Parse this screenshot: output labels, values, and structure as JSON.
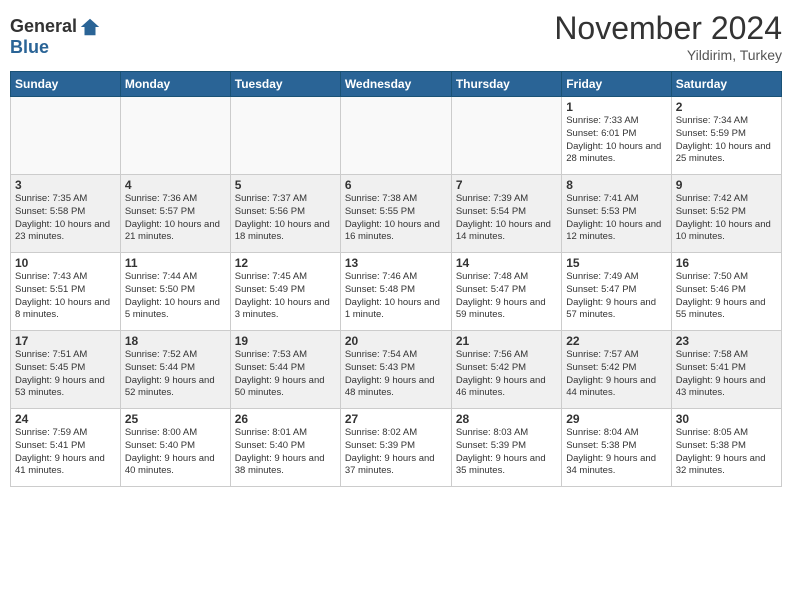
{
  "header": {
    "logo_general": "General",
    "logo_blue": "Blue",
    "month_title": "November 2024",
    "location": "Yildirim, Turkey"
  },
  "days_of_week": [
    "Sunday",
    "Monday",
    "Tuesday",
    "Wednesday",
    "Thursday",
    "Friday",
    "Saturday"
  ],
  "weeks": [
    [
      {
        "day": "",
        "empty": true
      },
      {
        "day": "",
        "empty": true
      },
      {
        "day": "",
        "empty": true
      },
      {
        "day": "",
        "empty": true
      },
      {
        "day": "",
        "empty": true
      },
      {
        "day": "1",
        "sunrise": "7:33 AM",
        "sunset": "6:01 PM",
        "daylight": "10 hours and 28 minutes."
      },
      {
        "day": "2",
        "sunrise": "7:34 AM",
        "sunset": "5:59 PM",
        "daylight": "10 hours and 25 minutes."
      }
    ],
    [
      {
        "day": "3",
        "sunrise": "7:35 AM",
        "sunset": "5:58 PM",
        "daylight": "10 hours and 23 minutes."
      },
      {
        "day": "4",
        "sunrise": "7:36 AM",
        "sunset": "5:57 PM",
        "daylight": "10 hours and 21 minutes."
      },
      {
        "day": "5",
        "sunrise": "7:37 AM",
        "sunset": "5:56 PM",
        "daylight": "10 hours and 18 minutes."
      },
      {
        "day": "6",
        "sunrise": "7:38 AM",
        "sunset": "5:55 PM",
        "daylight": "10 hours and 16 minutes."
      },
      {
        "day": "7",
        "sunrise": "7:39 AM",
        "sunset": "5:54 PM",
        "daylight": "10 hours and 14 minutes."
      },
      {
        "day": "8",
        "sunrise": "7:41 AM",
        "sunset": "5:53 PM",
        "daylight": "10 hours and 12 minutes."
      },
      {
        "day": "9",
        "sunrise": "7:42 AM",
        "sunset": "5:52 PM",
        "daylight": "10 hours and 10 minutes."
      }
    ],
    [
      {
        "day": "10",
        "sunrise": "7:43 AM",
        "sunset": "5:51 PM",
        "daylight": "10 hours and 8 minutes."
      },
      {
        "day": "11",
        "sunrise": "7:44 AM",
        "sunset": "5:50 PM",
        "daylight": "10 hours and 5 minutes."
      },
      {
        "day": "12",
        "sunrise": "7:45 AM",
        "sunset": "5:49 PM",
        "daylight": "10 hours and 3 minutes."
      },
      {
        "day": "13",
        "sunrise": "7:46 AM",
        "sunset": "5:48 PM",
        "daylight": "10 hours and 1 minute."
      },
      {
        "day": "14",
        "sunrise": "7:48 AM",
        "sunset": "5:47 PM",
        "daylight": "9 hours and 59 minutes."
      },
      {
        "day": "15",
        "sunrise": "7:49 AM",
        "sunset": "5:47 PM",
        "daylight": "9 hours and 57 minutes."
      },
      {
        "day": "16",
        "sunrise": "7:50 AM",
        "sunset": "5:46 PM",
        "daylight": "9 hours and 55 minutes."
      }
    ],
    [
      {
        "day": "17",
        "sunrise": "7:51 AM",
        "sunset": "5:45 PM",
        "daylight": "9 hours and 53 minutes."
      },
      {
        "day": "18",
        "sunrise": "7:52 AM",
        "sunset": "5:44 PM",
        "daylight": "9 hours and 52 minutes."
      },
      {
        "day": "19",
        "sunrise": "7:53 AM",
        "sunset": "5:44 PM",
        "daylight": "9 hours and 50 minutes."
      },
      {
        "day": "20",
        "sunrise": "7:54 AM",
        "sunset": "5:43 PM",
        "daylight": "9 hours and 48 minutes."
      },
      {
        "day": "21",
        "sunrise": "7:56 AM",
        "sunset": "5:42 PM",
        "daylight": "9 hours and 46 minutes."
      },
      {
        "day": "22",
        "sunrise": "7:57 AM",
        "sunset": "5:42 PM",
        "daylight": "9 hours and 44 minutes."
      },
      {
        "day": "23",
        "sunrise": "7:58 AM",
        "sunset": "5:41 PM",
        "daylight": "9 hours and 43 minutes."
      }
    ],
    [
      {
        "day": "24",
        "sunrise": "7:59 AM",
        "sunset": "5:41 PM",
        "daylight": "9 hours and 41 minutes."
      },
      {
        "day": "25",
        "sunrise": "8:00 AM",
        "sunset": "5:40 PM",
        "daylight": "9 hours and 40 minutes."
      },
      {
        "day": "26",
        "sunrise": "8:01 AM",
        "sunset": "5:40 PM",
        "daylight": "9 hours and 38 minutes."
      },
      {
        "day": "27",
        "sunrise": "8:02 AM",
        "sunset": "5:39 PM",
        "daylight": "9 hours and 37 minutes."
      },
      {
        "day": "28",
        "sunrise": "8:03 AM",
        "sunset": "5:39 PM",
        "daylight": "9 hours and 35 minutes."
      },
      {
        "day": "29",
        "sunrise": "8:04 AM",
        "sunset": "5:38 PM",
        "daylight": "9 hours and 34 minutes."
      },
      {
        "day": "30",
        "sunrise": "8:05 AM",
        "sunset": "5:38 PM",
        "daylight": "9 hours and 32 minutes."
      }
    ]
  ]
}
